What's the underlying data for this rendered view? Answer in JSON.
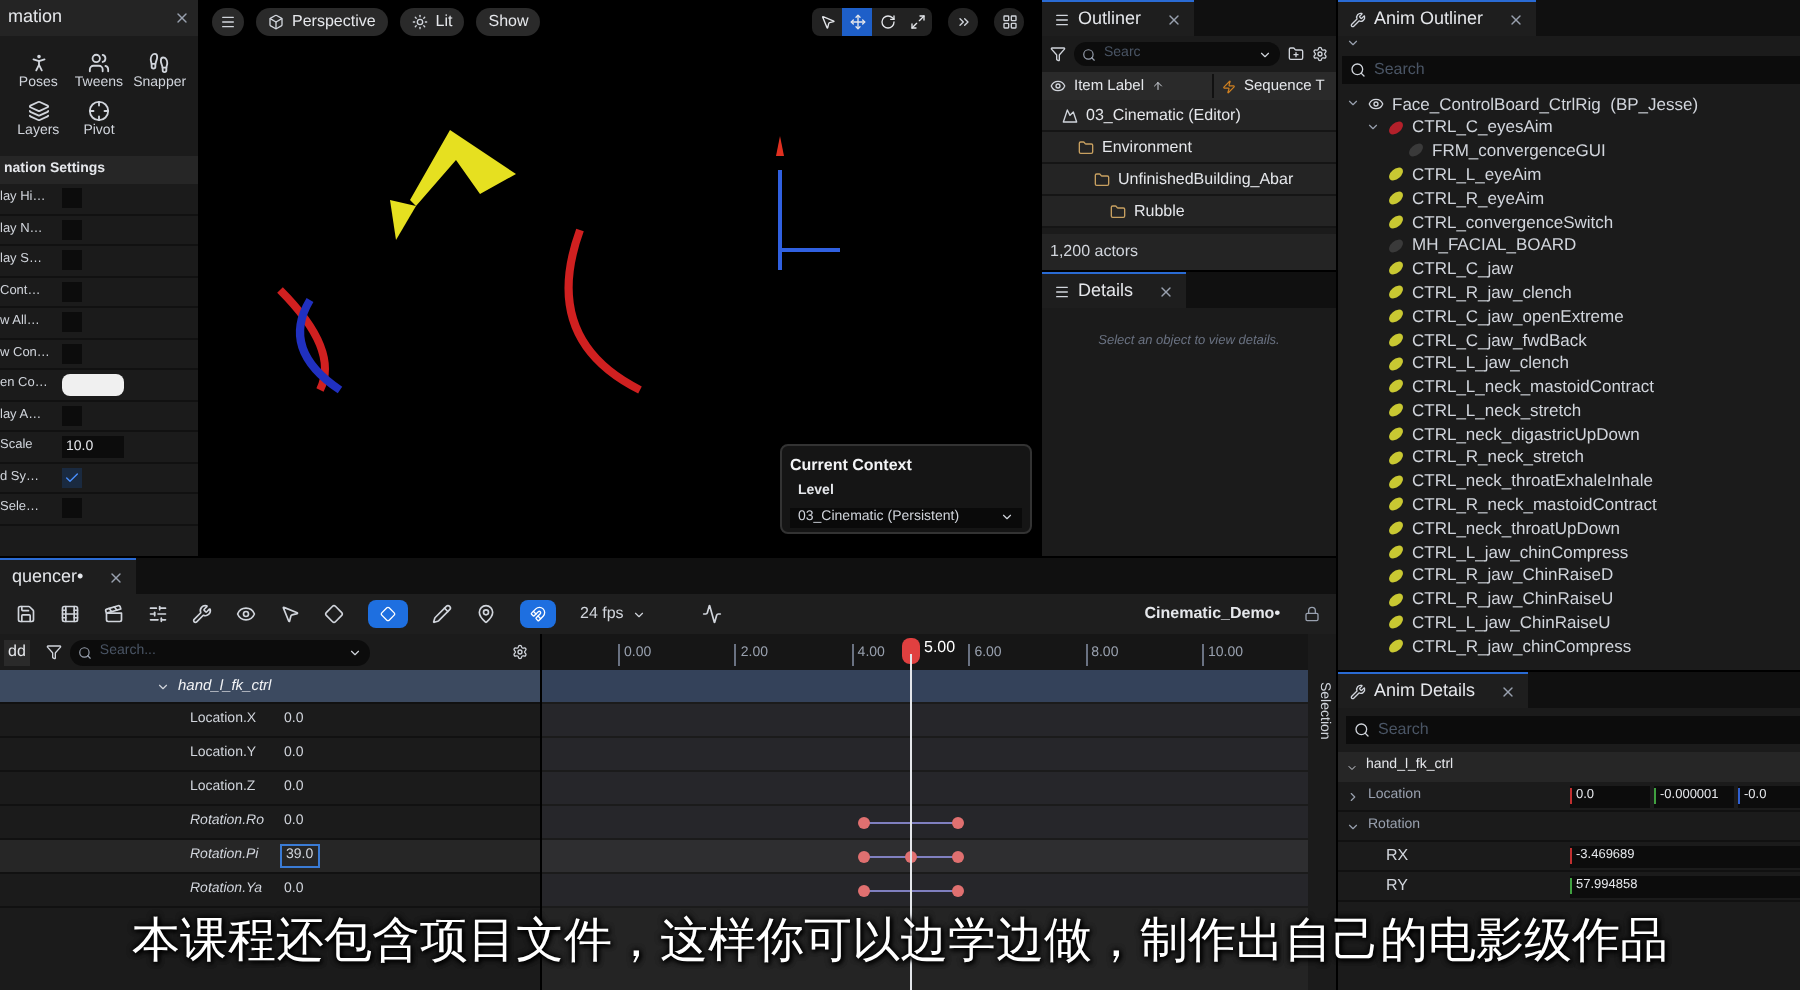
{
  "animation_panel": {
    "title": "mation",
    "tools": [
      {
        "label": "Poses",
        "kind": "poses"
      },
      {
        "label": "Tweens",
        "kind": "tweens"
      },
      {
        "label": "Snapper",
        "kind": "snapper"
      },
      {
        "label": "Layers",
        "kind": "layers"
      },
      {
        "label": "Pivot",
        "kind": "pivot"
      }
    ],
    "section": "nation Settings",
    "settings": [
      {
        "label": "lay Hi…",
        "kind": "checkbox",
        "checked": false
      },
      {
        "label": "lay N…",
        "kind": "checkbox",
        "checked": false
      },
      {
        "label": "lay S…",
        "kind": "checkbox",
        "checked": false
      },
      {
        "label": "Cont…",
        "kind": "checkbox",
        "checked": false
      },
      {
        "label": "w All…",
        "kind": "checkbox",
        "checked": false
      },
      {
        "label": "w Con…",
        "kind": "checkbox",
        "checked": false
      },
      {
        "label": "en Co…",
        "kind": "color"
      },
      {
        "label": "lay A…",
        "kind": "checkbox",
        "checked": false
      },
      {
        "label": "Scale",
        "kind": "number",
        "value": "10.0"
      },
      {
        "label": "d Sy…",
        "kind": "checkbox",
        "checked": true
      },
      {
        "label": "Sele…",
        "kind": "checkbox",
        "checked": false
      }
    ]
  },
  "viewport": {
    "view_buttons": [
      {
        "label": "Perspective",
        "kind": "perspective"
      },
      {
        "label": "Lit",
        "kind": "lit"
      },
      {
        "label": "Show",
        "kind": "plain"
      }
    ],
    "transform_tools": [
      {
        "kind": "select",
        "selected": false
      },
      {
        "kind": "move",
        "selected": true
      },
      {
        "kind": "rotate",
        "selected": false
      },
      {
        "kind": "scale",
        "selected": false
      }
    ],
    "context_popup": {
      "title": "Current Context",
      "label": "Level",
      "value": "03_Cinematic (Persistent)"
    }
  },
  "outliner": {
    "title": "Outliner",
    "search": {
      "placeholder": "Searc"
    },
    "columns": [
      "Item Label",
      "Sequence T"
    ],
    "tree": [
      {
        "label": "03_Cinematic (Editor)",
        "kind": "level",
        "children": [
          {
            "label": "Environment",
            "kind": "folder",
            "children": [
              {
                "label": "UnfinishedBuilding_Abar",
                "kind": "folder",
                "children": [
                  {
                    "label": "Rubble",
                    "kind": "folder"
                  }
                ]
              }
            ]
          }
        ]
      }
    ],
    "count": "1,200 actors"
  },
  "details": {
    "title": "Details",
    "hint": "Select an object to view details."
  },
  "anim_outliner": {
    "title": "Anim Outliner",
    "search": {
      "placeholder": "Search"
    },
    "tree": [
      {
        "label": "Face_ControlBoard_CtrlRig  (BP_Jesse)",
        "kind": "rig",
        "children": [
          {
            "label": "CTRL_C_eyesAim",
            "kind": "control",
            "color": "#b3202a",
            "children": [
              {
                "label": "FRM_convergenceGUI",
                "kind": "frame"
              }
            ]
          },
          {
            "label": "CTRL_L_eyeAim",
            "kind": "control",
            "color": "#c9c832"
          },
          {
            "label": "CTRL_R_eyeAim",
            "kind": "control",
            "color": "#c9c832"
          },
          {
            "label": "CTRL_convergenceSwitch",
            "kind": "control",
            "color": "#c9c832"
          },
          {
            "label": "MH_FACIAL_BOARD",
            "kind": "frame"
          },
          {
            "label": "CTRL_C_jaw",
            "kind": "control",
            "color": "#c9c832"
          },
          {
            "label": "CTRL_R_jaw_clench",
            "kind": "control",
            "color": "#c9c832"
          },
          {
            "label": "CTRL_C_jaw_openExtreme",
            "kind": "control",
            "color": "#c9c832"
          },
          {
            "label": "CTRL_C_jaw_fwdBack",
            "kind": "control",
            "color": "#c9c832"
          },
          {
            "label": "CTRL_L_jaw_clench",
            "kind": "control",
            "color": "#c9c832"
          },
          {
            "label": "CTRL_L_neck_mastoidContract",
            "kind": "control",
            "color": "#c9c832"
          },
          {
            "label": "CTRL_L_neck_stretch",
            "kind": "control",
            "color": "#c9c832"
          },
          {
            "label": "CTRL_neck_digastricUpDown",
            "kind": "control",
            "color": "#c9c832"
          },
          {
            "label": "CTRL_R_neck_stretch",
            "kind": "control",
            "color": "#c9c832"
          },
          {
            "label": "CTRL_neck_throatExhaleInhale",
            "kind": "control",
            "color": "#c9c832"
          },
          {
            "label": "CTRL_R_neck_mastoidContract",
            "kind": "control",
            "color": "#c9c832"
          },
          {
            "label": "CTRL_neck_throatUpDown",
            "kind": "control",
            "color": "#c9c832"
          },
          {
            "label": "CTRL_L_jaw_chinCompress",
            "kind": "control",
            "color": "#c9c832"
          },
          {
            "label": "CTRL_R_jaw_ChinRaiseD",
            "kind": "control",
            "color": "#c9c832"
          },
          {
            "label": "CTRL_R_jaw_ChinRaiseU",
            "kind": "control",
            "color": "#c9c832"
          },
          {
            "label": "CTRL_L_jaw_ChinRaiseU",
            "kind": "control",
            "color": "#c9c832"
          },
          {
            "label": "CTRL_R_jaw_chinCompress",
            "kind": "control",
            "color": "#c9c832"
          }
        ]
      }
    ]
  },
  "sequencer": {
    "title": "quencer•",
    "fps": "24 fps",
    "sequence": "Cinematic_Demo•",
    "add_button": "dd",
    "search": {
      "placeholder": "Search..."
    },
    "ruler": {
      "ticks": [
        "0.00",
        "2.00",
        "4.00",
        "6.00",
        "8.00",
        "10.00"
      ],
      "playhead": "5.00"
    },
    "side_label": "Selection",
    "tracks": [
      {
        "label": "hand_l_fk_ctrl",
        "kind": "group"
      },
      {
        "label": "Location.X",
        "kind": "channel",
        "value": "0.0",
        "selected": false
      },
      {
        "label": "Location.Y",
        "kind": "channel",
        "value": "0.0",
        "selected": false
      },
      {
        "label": "Location.Z",
        "kind": "channel",
        "value": "0.0",
        "selected": false
      },
      {
        "label": "Rotation.Ro",
        "kind": "channel",
        "value": "0.0",
        "selected": false,
        "keyframes": [
          {
            "selected": false
          },
          {
            "selected": false
          }
        ]
      },
      {
        "label": "Rotation.Pi",
        "kind": "channel",
        "value": "39.0",
        "selected": true,
        "keyframes": [
          {
            "selected": false
          },
          {
            "selected": false
          },
          {
            "selected": false
          }
        ]
      },
      {
        "label": "Rotation.Ya",
        "kind": "channel",
        "value": "0.0",
        "selected": false,
        "keyframes": [
          {
            "selected": false
          },
          {
            "selected": false
          }
        ]
      }
    ]
  },
  "anim_details": {
    "title": "Anim Details",
    "search": {
      "placeholder": "Search"
    },
    "control": "hand_l_fk_ctrl",
    "properties": [
      {
        "label": "Location",
        "kind": "vector",
        "expanded": false,
        "values": [
          "0.0",
          "-0.000001",
          "-0.0"
        ]
      },
      {
        "label": "Rotation",
        "kind": "group",
        "expanded": true
      },
      {
        "label": "RX",
        "kind": "scalar",
        "value": "-3.469689"
      },
      {
        "label": "RY",
        "kind": "scalar",
        "value": "57.994858"
      }
    ]
  },
  "caption": "本课程还包含项目文件，这样你可以边学边做，制作出自己的电影级作品"
}
